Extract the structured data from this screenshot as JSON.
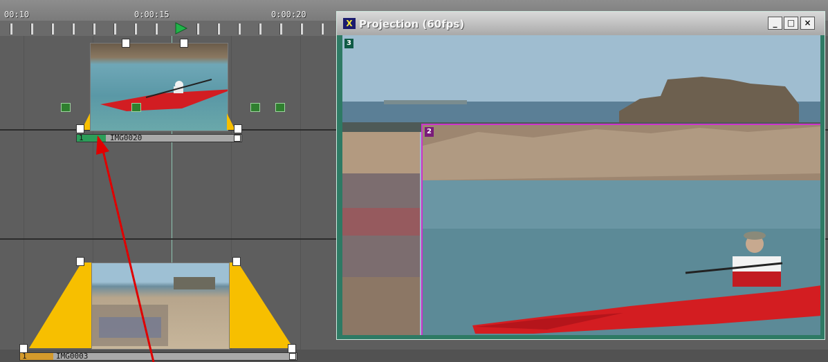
{
  "timeline": {
    "ruler_labels": [
      "00:10",
      "0:00:15",
      "0:00:20"
    ],
    "clips": [
      {
        "name": "IMG0020",
        "start_marker": "1"
      },
      {
        "name": "IMG0003",
        "start_marker": "1"
      }
    ]
  },
  "projection": {
    "title": "Projection (60fps)",
    "window_icon": "X",
    "buttons": {
      "minimize": "_",
      "maximize": "□",
      "close": "×"
    },
    "layer_badges": [
      "3",
      "2"
    ]
  },
  "colors": {
    "accent_yellow": "#f7bf00",
    "playhead": "#21b34a",
    "pip_border": "#cc33cc",
    "annotation_arrow": "#e00000"
  }
}
